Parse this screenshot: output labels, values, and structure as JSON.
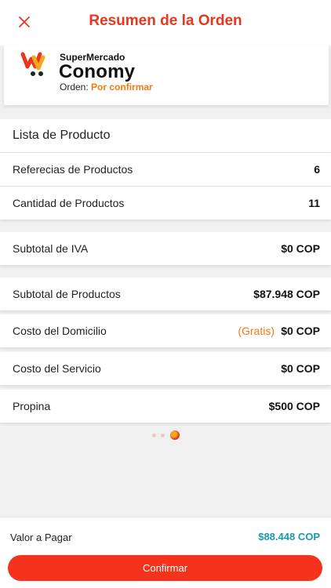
{
  "header": {
    "title": "Resumen de la Orden"
  },
  "store": {
    "kind": "SuperMercado",
    "name": "Conomy",
    "order_label": "Orden:",
    "order_status": "Por confirmar"
  },
  "products": {
    "section_title": "Lista de Producto",
    "references_label": "Referecias de Productos",
    "references_value": "6",
    "quantity_label": "Cantidad de Productos",
    "quantity_value": "11"
  },
  "summary": {
    "iva_label": "Subtotal de IVA",
    "iva_value": "$0 COP",
    "products_subtotal_label": "Subtotal de Productos",
    "products_subtotal_value": "$87.948 COP",
    "delivery_label": "Costo del Domicilio",
    "delivery_note": "(Gratis)",
    "delivery_value": "$0 COP",
    "service_label": "Costo del Servicio",
    "service_value": "$0 COP",
    "tip_label": "Propina",
    "tip_value": "$500 COP"
  },
  "pager": {
    "count": 3,
    "active_index": 2
  },
  "footer": {
    "pay_label": "Valor a Pagar",
    "pay_value": "$88.448 COP",
    "confirm_label": "Confirmar"
  },
  "colors": {
    "brand_red": "#e8361f",
    "button_red": "#f5331d",
    "status_orange": "#f07a12",
    "total_teal": "#1a9aa8"
  },
  "icons": {
    "close": "close-icon",
    "logo": "supermercado-logo-icon"
  }
}
